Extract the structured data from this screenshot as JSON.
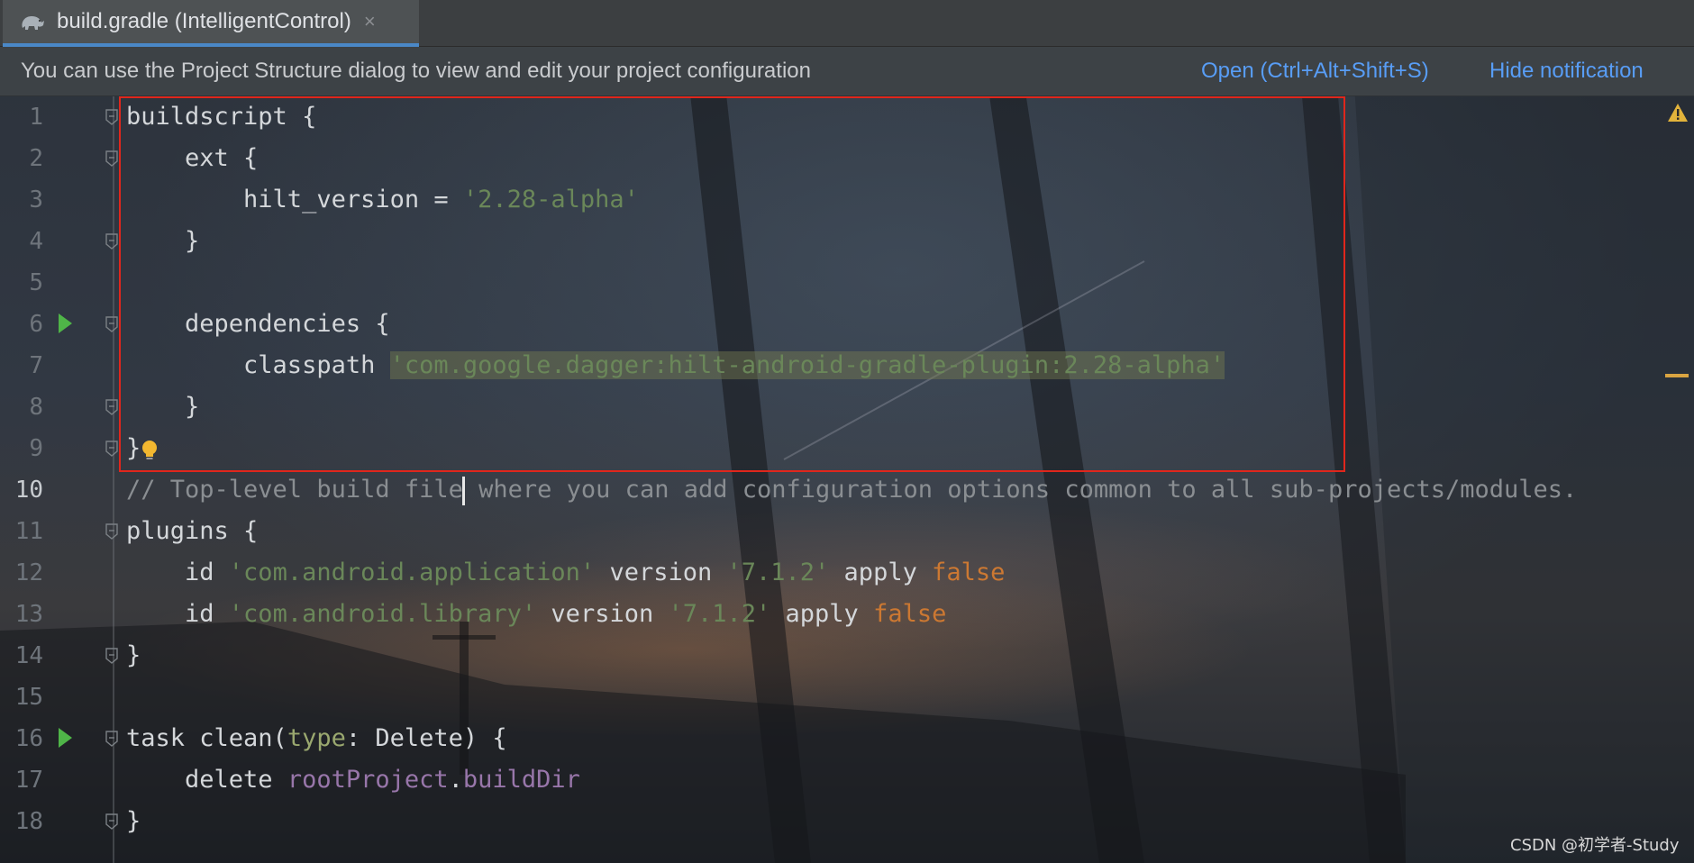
{
  "tab": {
    "title": "build.gradle (IntelligentControl)",
    "close_glyph": "×",
    "icon": "gradle-elephant-icon"
  },
  "notification": {
    "text": "You can use the Project Structure dialog to view and edit your project configuration",
    "open_link": "Open (Ctrl+Alt+Shift+S)",
    "hide_link": "Hide notification"
  },
  "lines": [
    {
      "n": "1",
      "tokens": [
        {
          "t": "buildscript {",
          "c": "plain"
        }
      ]
    },
    {
      "n": "2",
      "tokens": [
        {
          "t": "    ext {",
          "c": "plain"
        }
      ]
    },
    {
      "n": "3",
      "tokens": [
        {
          "t": "        hilt_version = ",
          "c": "plain"
        },
        {
          "t": "'2.28-alpha'",
          "c": "str"
        }
      ]
    },
    {
      "n": "4",
      "tokens": [
        {
          "t": "    }",
          "c": "plain"
        }
      ]
    },
    {
      "n": "5",
      "tokens": []
    },
    {
      "n": "6",
      "tokens": [
        {
          "t": "    dependencies {",
          "c": "plain"
        }
      ]
    },
    {
      "n": "7",
      "tokens": [
        {
          "t": "        classpath ",
          "c": "plain"
        },
        {
          "t": "'com.google.dagger:hilt-android-gradle-plugin:2.28-alpha'",
          "c": "strhl"
        }
      ]
    },
    {
      "n": "8",
      "tokens": [
        {
          "t": "    }",
          "c": "plain"
        }
      ]
    },
    {
      "n": "9",
      "tokens": [
        {
          "t": "}",
          "c": "plain"
        }
      ]
    },
    {
      "n": "10",
      "tokens": [
        {
          "t": "// Top-level build file",
          "c": "comment"
        },
        {
          "t": "",
          "c": "caret"
        },
        {
          "t": " where you can add configuration options common to all sub-projects/modules.",
          "c": "comment"
        }
      ]
    },
    {
      "n": "11",
      "tokens": [
        {
          "t": "plugins {",
          "c": "plain"
        }
      ]
    },
    {
      "n": "12",
      "tokens": [
        {
          "t": "    id ",
          "c": "plain"
        },
        {
          "t": "'com.android.application'",
          "c": "str"
        },
        {
          "t": " version ",
          "c": "plain"
        },
        {
          "t": "'7.1.2'",
          "c": "str"
        },
        {
          "t": " apply ",
          "c": "plain"
        },
        {
          "t": "false",
          "c": "orange"
        }
      ]
    },
    {
      "n": "13",
      "tokens": [
        {
          "t": "    id ",
          "c": "plain"
        },
        {
          "t": "'com.android.library'",
          "c": "str"
        },
        {
          "t": " version ",
          "c": "plain"
        },
        {
          "t": "'7.1.2'",
          "c": "str"
        },
        {
          "t": " apply ",
          "c": "plain"
        },
        {
          "t": "false",
          "c": "orange"
        }
      ]
    },
    {
      "n": "14",
      "tokens": [
        {
          "t": "}",
          "c": "plain"
        }
      ]
    },
    {
      "n": "15",
      "tokens": []
    },
    {
      "n": "16",
      "tokens": [
        {
          "t": "task clean(",
          "c": "plain"
        },
        {
          "t": "type",
          "c": "type"
        },
        {
          "t": ": Delete) {",
          "c": "plain"
        }
      ]
    },
    {
      "n": "17",
      "tokens": [
        {
          "t": "    delete ",
          "c": "plain"
        },
        {
          "t": "rootProject",
          "c": "purple"
        },
        {
          "t": ".",
          "c": "plain"
        },
        {
          "t": "buildDir",
          "c": "purple"
        }
      ]
    },
    {
      "n": "18",
      "tokens": [
        {
          "t": "}",
          "c": "plain"
        }
      ]
    }
  ],
  "current_line": "10",
  "run_lines": [
    "6",
    "16"
  ],
  "fold_lines": [
    "1",
    "2",
    "4",
    "6",
    "8",
    "9",
    "11",
    "14",
    "16",
    "18"
  ],
  "bulb_line": "9",
  "watermark": "CSDN @初学者-Study",
  "colors": {
    "accent": "#4a88c7",
    "link": "#589df6",
    "string": "#6a8759",
    "keyword": "#cc7832",
    "field": "#9876aa",
    "highlight_box": "#e0261c"
  }
}
